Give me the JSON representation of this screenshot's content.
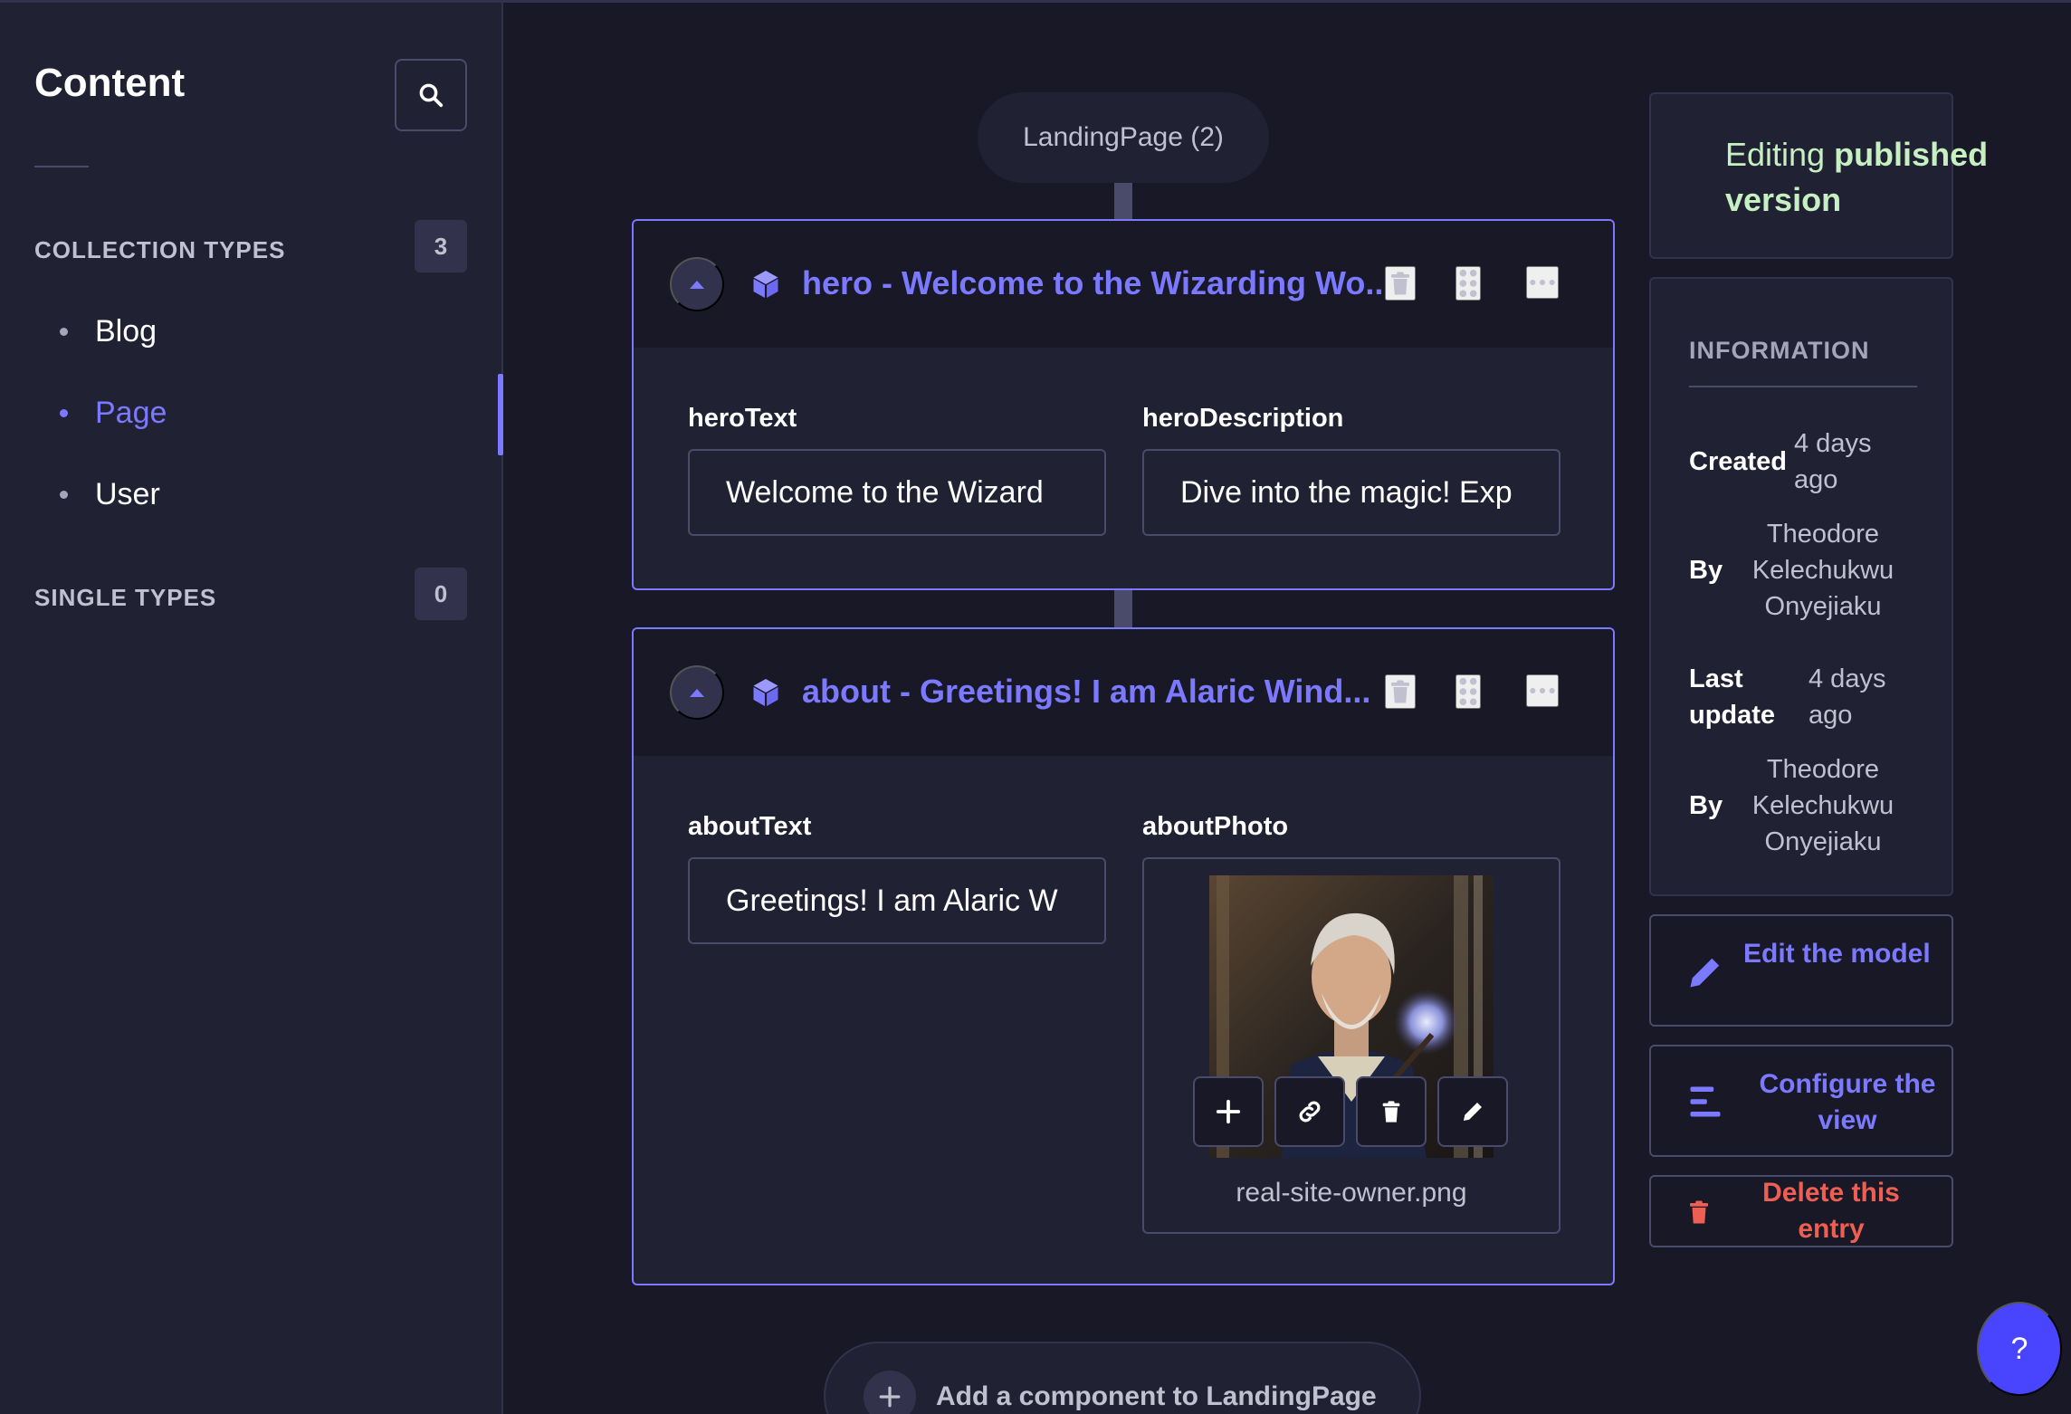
{
  "sidebar": {
    "title": "Content",
    "collection_types": {
      "label": "COLLECTION TYPES",
      "count": "3",
      "items": [
        {
          "label": "Blog"
        },
        {
          "label": "Page"
        },
        {
          "label": "User"
        }
      ]
    },
    "single_types": {
      "label": "SINGLE TYPES",
      "count": "0"
    },
    "active_item": "Page"
  },
  "main": {
    "zone_label": "LandingPage (2)",
    "components": [
      {
        "title": "hero - Welcome to the Wizarding Wo...",
        "fields": [
          {
            "label": "heroText",
            "value": "Welcome to the Wizard"
          },
          {
            "label": "heroDescription",
            "value": "Dive into the magic! Exp"
          }
        ]
      },
      {
        "title": "about - Greetings! I am Alaric Wind...",
        "fields": [
          {
            "label": "aboutText",
            "value": "Greetings! I am Alaric W"
          },
          {
            "label": "aboutPhoto",
            "file_name": "real-site-owner.png"
          }
        ]
      }
    ],
    "add_component_label": "Add a component to LandingPage"
  },
  "right_panel": {
    "status_prefix": "Editing ",
    "status_bold": "published version",
    "information": {
      "heading": "INFORMATION",
      "created_label": "Created",
      "created_value": "4 days ago",
      "created_by_label": "By",
      "created_by_value": "Theodore Kelechukwu Onyejiaku",
      "updated_label": "Last update",
      "updated_value": "4 days ago",
      "updated_by_label": "By",
      "updated_by_value": "Theodore Kelechukwu Onyejiaku"
    },
    "actions": {
      "edit_model": "Edit the model",
      "configure_view": "Configure the view",
      "delete_entry": "Delete this entry"
    }
  },
  "help_label": "?",
  "colors": {
    "accent": "#7b79ff",
    "danger": "#ee5e52",
    "success_text": "#c6f0c2",
    "background": "#181826",
    "surface": "#212134"
  }
}
